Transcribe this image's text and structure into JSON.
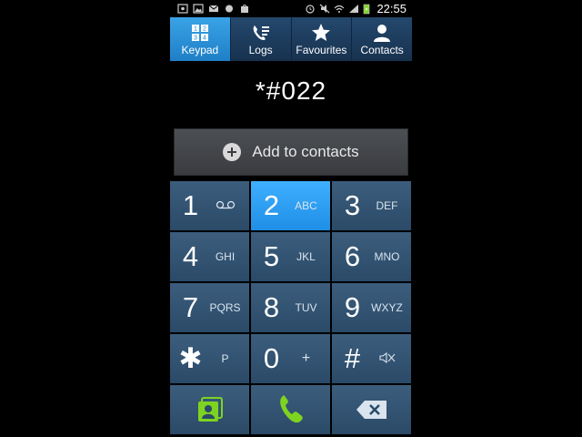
{
  "status": {
    "time": "22:55"
  },
  "tabs": [
    {
      "label": "Keypad",
      "icon": "keypad-icon",
      "active": true
    },
    {
      "label": "Logs",
      "icon": "logs-icon",
      "active": false
    },
    {
      "label": "Favourites",
      "icon": "star-icon",
      "active": false
    },
    {
      "label": "Contacts",
      "icon": "contacts-icon",
      "active": false
    }
  ],
  "dialed_number": "*#022",
  "add_contact": {
    "label": "Add to contacts"
  },
  "keys": [
    {
      "digit": "1",
      "letters": ""
    },
    {
      "digit": "2",
      "letters": "ABC"
    },
    {
      "digit": "3",
      "letters": "DEF"
    },
    {
      "digit": "4",
      "letters": "GHI"
    },
    {
      "digit": "5",
      "letters": "JKL"
    },
    {
      "digit": "6",
      "letters": "MNO"
    },
    {
      "digit": "7",
      "letters": "PQRS"
    },
    {
      "digit": "8",
      "letters": "TUV"
    },
    {
      "digit": "9",
      "letters": "WXYZ"
    },
    {
      "digit": "✱",
      "letters": "P"
    },
    {
      "digit": "0",
      "letters": "+"
    },
    {
      "digit": "#",
      "letters": ""
    }
  ],
  "colors": {
    "accent": "#2a9af0",
    "call_green": "#7ed321"
  }
}
